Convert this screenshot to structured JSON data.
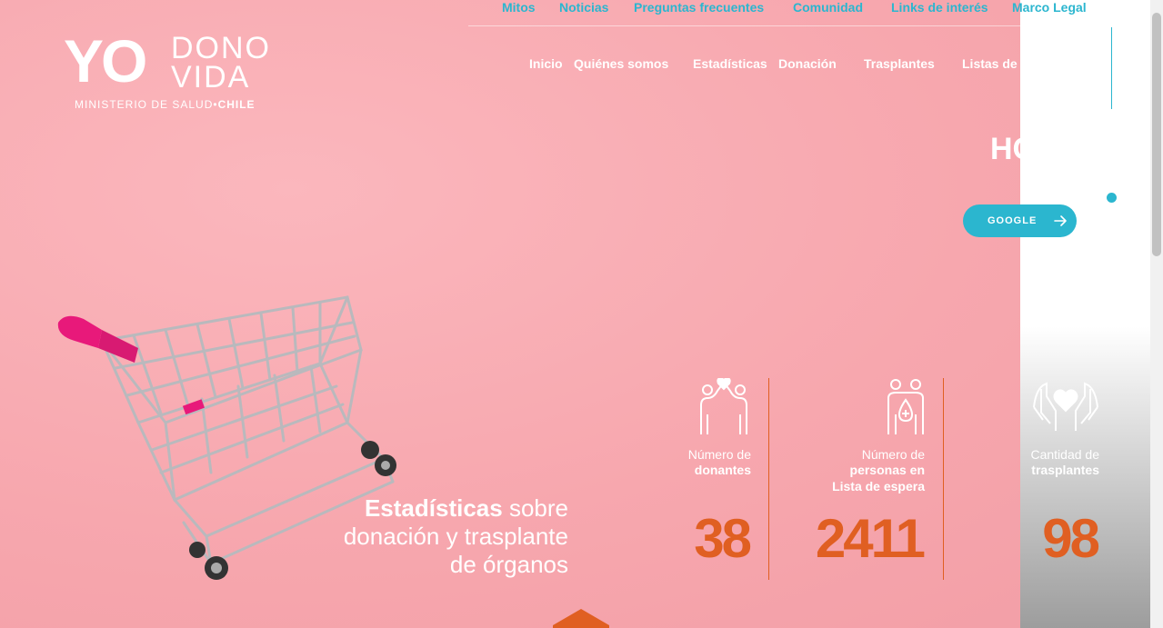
{
  "colors": {
    "brand_cyan": "#2bb6cf",
    "accent_orange": "#e05f22",
    "hero_pink": "#f7a7ae"
  },
  "logo": {
    "yo": "YO",
    "dono": "DONO",
    "vida": "VIDA",
    "ministry": "MINISTERIO DE SALUD",
    "country": "CHILE"
  },
  "top_nav": [
    "Mitos",
    "Noticias",
    "Preguntas frecuentes",
    "Comunidad",
    "Links de interés",
    "Marco Legal"
  ],
  "main_nav": [
    "Inicio",
    "Quiénes somos",
    "Estadísticas",
    "Donación",
    "Trasplantes",
    "Listas de"
  ],
  "hero": {
    "title_partial": "HO",
    "button_label": "GOOGLE",
    "button_icon": "arrow-right-icon"
  },
  "stats_heading": {
    "bold": "Estadísticas",
    "rest": "sobre",
    "line2": "donación y trasplante",
    "line3": "de órganos"
  },
  "stats": [
    {
      "icon": "donors-icon",
      "label_line1": "Número de",
      "label_line2": "donantes",
      "label_line3": "",
      "value": "38"
    },
    {
      "icon": "waiting-list-icon",
      "label_line1": "Número de",
      "label_line2": "personas en",
      "label_line3": "Lista de espera",
      "value": "2411"
    },
    {
      "icon": "hands-heart-icon",
      "label_line1": "Cantidad de",
      "label_line2": "trasplantes",
      "label_line3": "",
      "value": "98"
    }
  ],
  "scroll_icon": "chevron-up-icon"
}
